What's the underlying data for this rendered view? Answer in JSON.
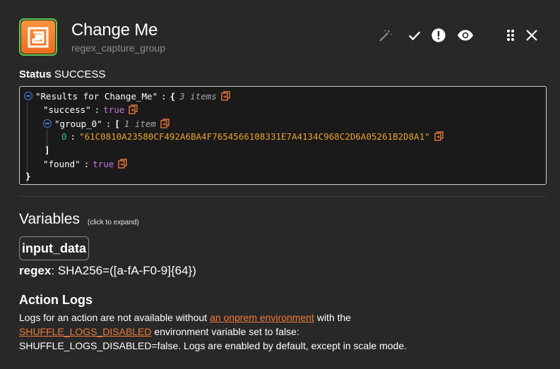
{
  "header": {
    "title": "Change Me",
    "subtitle": "regex_capture_group",
    "icons": [
      "magic-wand-icon",
      "check-icon",
      "alert-circle-icon",
      "eye-icon",
      "drag-handle-icon",
      "close-icon"
    ]
  },
  "status": {
    "label": "Status",
    "value": "SUCCESS"
  },
  "json_view": {
    "root_key": "\"Results for Change_Me\"",
    "root_open": "{",
    "root_count": "3 items",
    "success_key": "\"success\"",
    "success_value": "true",
    "group_key": "\"group_0\"",
    "group_open": "[",
    "group_count": "1 item",
    "item_index": "0",
    "item_value": "\"61C0810A23580CF492A6BA4F7654566108331E7A4134C968C2D6A05261B2D8A1\"",
    "group_close": "]",
    "found_key": "\"found\"",
    "found_value": "true",
    "root_close": "}",
    "colon": ":"
  },
  "variables": {
    "title": "Variables",
    "hint": "(click to expand)",
    "chip_label": "input_data",
    "regex_key": "regex",
    "regex_value": ": SHA256=([a-fA-F0-9]{64})"
  },
  "action_logs": {
    "title": "Action Logs",
    "text_1": "Logs for an action are not available without ",
    "link_1": "an onprem environment",
    "text_2": " with the",
    "link_2": "SHUFFLE_LOGS_DISABLED",
    "text_3": " environment variable set to false:",
    "text_4": "SHUFFLE_LOGS_DISABLED=false. Logs are enabled by default, except in scale mode."
  },
  "colors": {
    "background": "#282828",
    "accent_orange": "#f07a3a",
    "logo_border": "#5fca52",
    "bool_purple": "#c678dd",
    "string_amber": "#e7a232"
  }
}
